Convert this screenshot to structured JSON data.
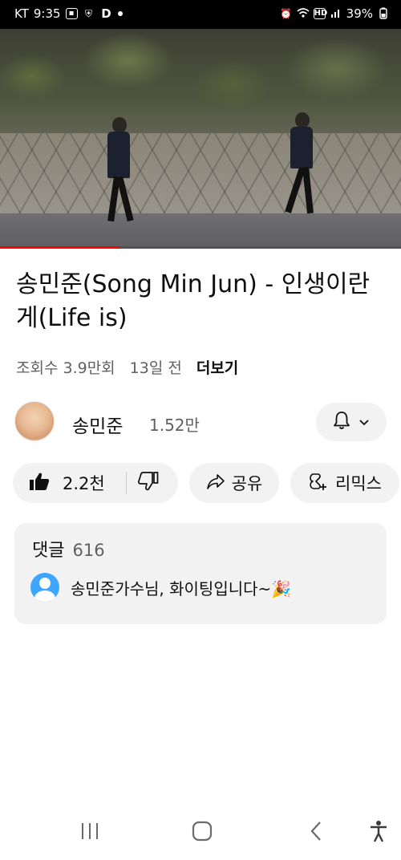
{
  "status_bar": {
    "carrier": "KT",
    "time": "9:35",
    "battery": "39%",
    "left_icons": [
      "gallery-icon",
      "vpn-icon",
      "d-app-icon",
      "notification-dot-icon"
    ],
    "right_icons": [
      "alarm-icon",
      "wifi-icon",
      "hd-icon",
      "signal-icon"
    ]
  },
  "video": {
    "progress": 0.3,
    "accent_color": "#ff0000"
  },
  "title": "송민준(Song Min Jun) - 인생이란 게(Life is)",
  "meta": {
    "views": "조회수 3.9만회",
    "age": "13일 전",
    "more": "더보기"
  },
  "channel": {
    "name": "송민준",
    "subscribers": "1.52만"
  },
  "actions": {
    "like_count": "2.2천",
    "share": "공유",
    "remix": "리믹스"
  },
  "comments": {
    "label": "댓글",
    "count": "616",
    "top_comment": "송민준가수님, 화이팅입니다~🎉"
  },
  "nav": {
    "icons": [
      "recent-apps-icon",
      "home-icon",
      "back-icon",
      "accessibility-icon"
    ]
  }
}
